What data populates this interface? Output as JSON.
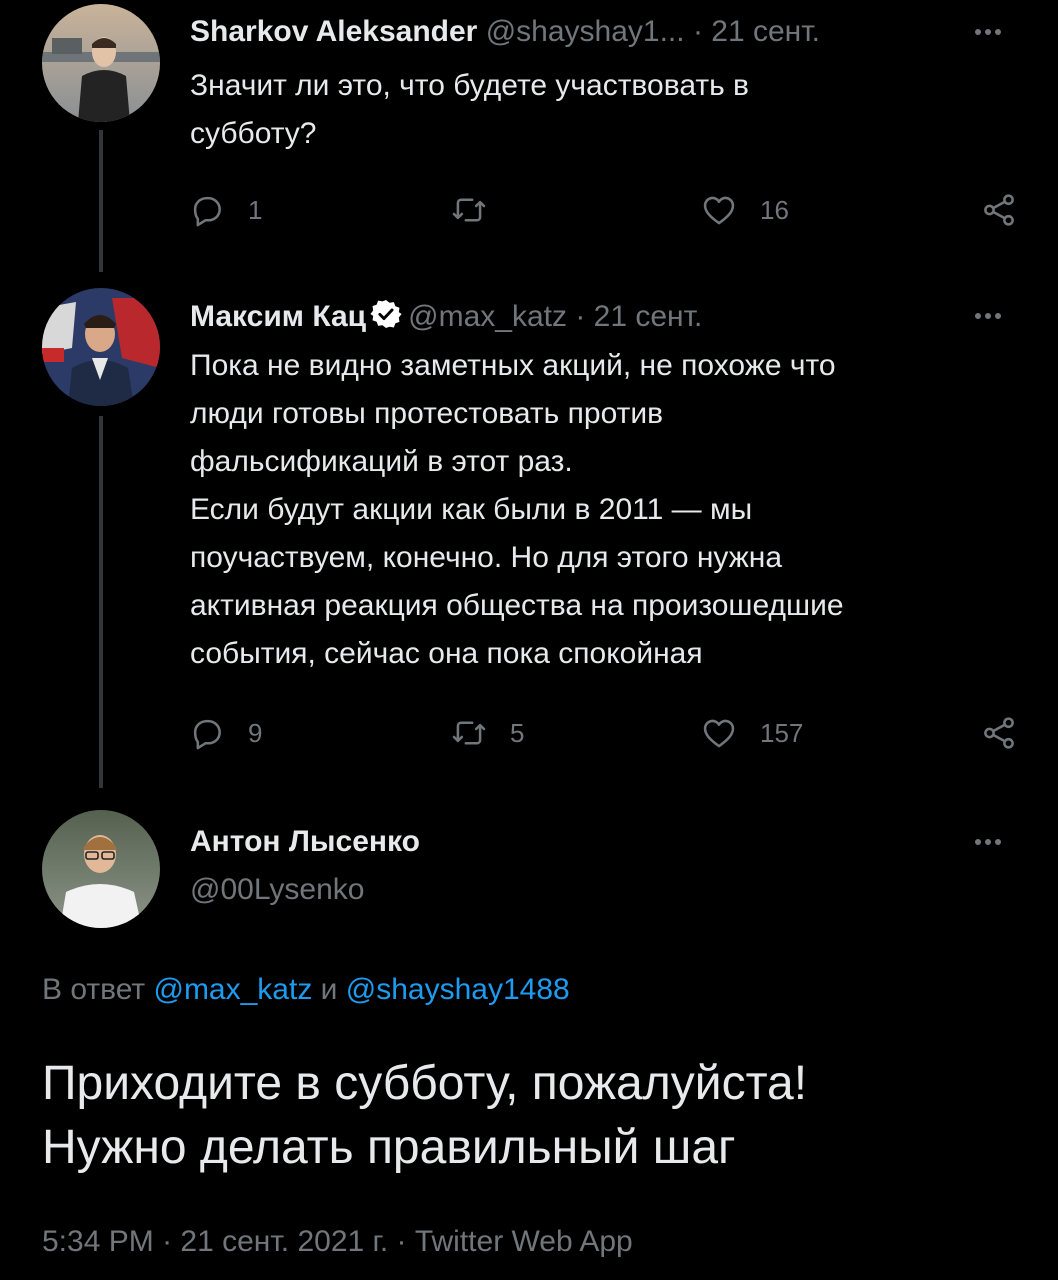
{
  "tweets": [
    {
      "name": "Sharkov Aleksander",
      "handle": "@shayshay1...",
      "separator": "·",
      "date": "21 сент.",
      "text_lines": [
        "Значит ли это, что будете участвовать в",
        "субботу?"
      ],
      "replies": "1",
      "retweets": "",
      "likes": "16"
    },
    {
      "name": "Максим Кац",
      "verified": true,
      "handle": "@max_katz",
      "separator": "·",
      "date": "21 сент.",
      "text_lines": [
        "Пока не видно заметных акций, не похоже что",
        "люди готовы протестовать против",
        "фальсификаций в этот раз.",
        "Если будут акции как были в 2011 — мы",
        "поучаствуем, конечно. Но для этого нужна",
        "активная реакция общества на произошедшие",
        "события, сейчас она пока спокойная"
      ],
      "replies": "9",
      "retweets": "5",
      "likes": "157"
    }
  ],
  "main_tweet": {
    "name": "Антон Лысенко",
    "handle": "@00Lysenko",
    "reply_prefix": "В ответ",
    "reply_user_1": "@max_katz",
    "reply_and": "и",
    "reply_user_2": "@shayshay1488",
    "text_lines": [
      "Приходите в субботу, пожалуйста!",
      "Нужно делать правильный шаг"
    ],
    "time": "5:34 PM",
    "separator": "·",
    "date": "21 сент. 2021 г.",
    "source": "Twitter Web App"
  },
  "icons": {
    "reply": "reply-icon",
    "retweet": "retweet-icon",
    "like": "heart-icon",
    "share": "share-icon",
    "more": "more-icon",
    "verified": "verified-badge-icon"
  },
  "colors": {
    "background": "#000000",
    "text": "#e7e9ea",
    "secondary": "#71767b",
    "link": "#1d9bf0",
    "thread_line": "#333639"
  }
}
